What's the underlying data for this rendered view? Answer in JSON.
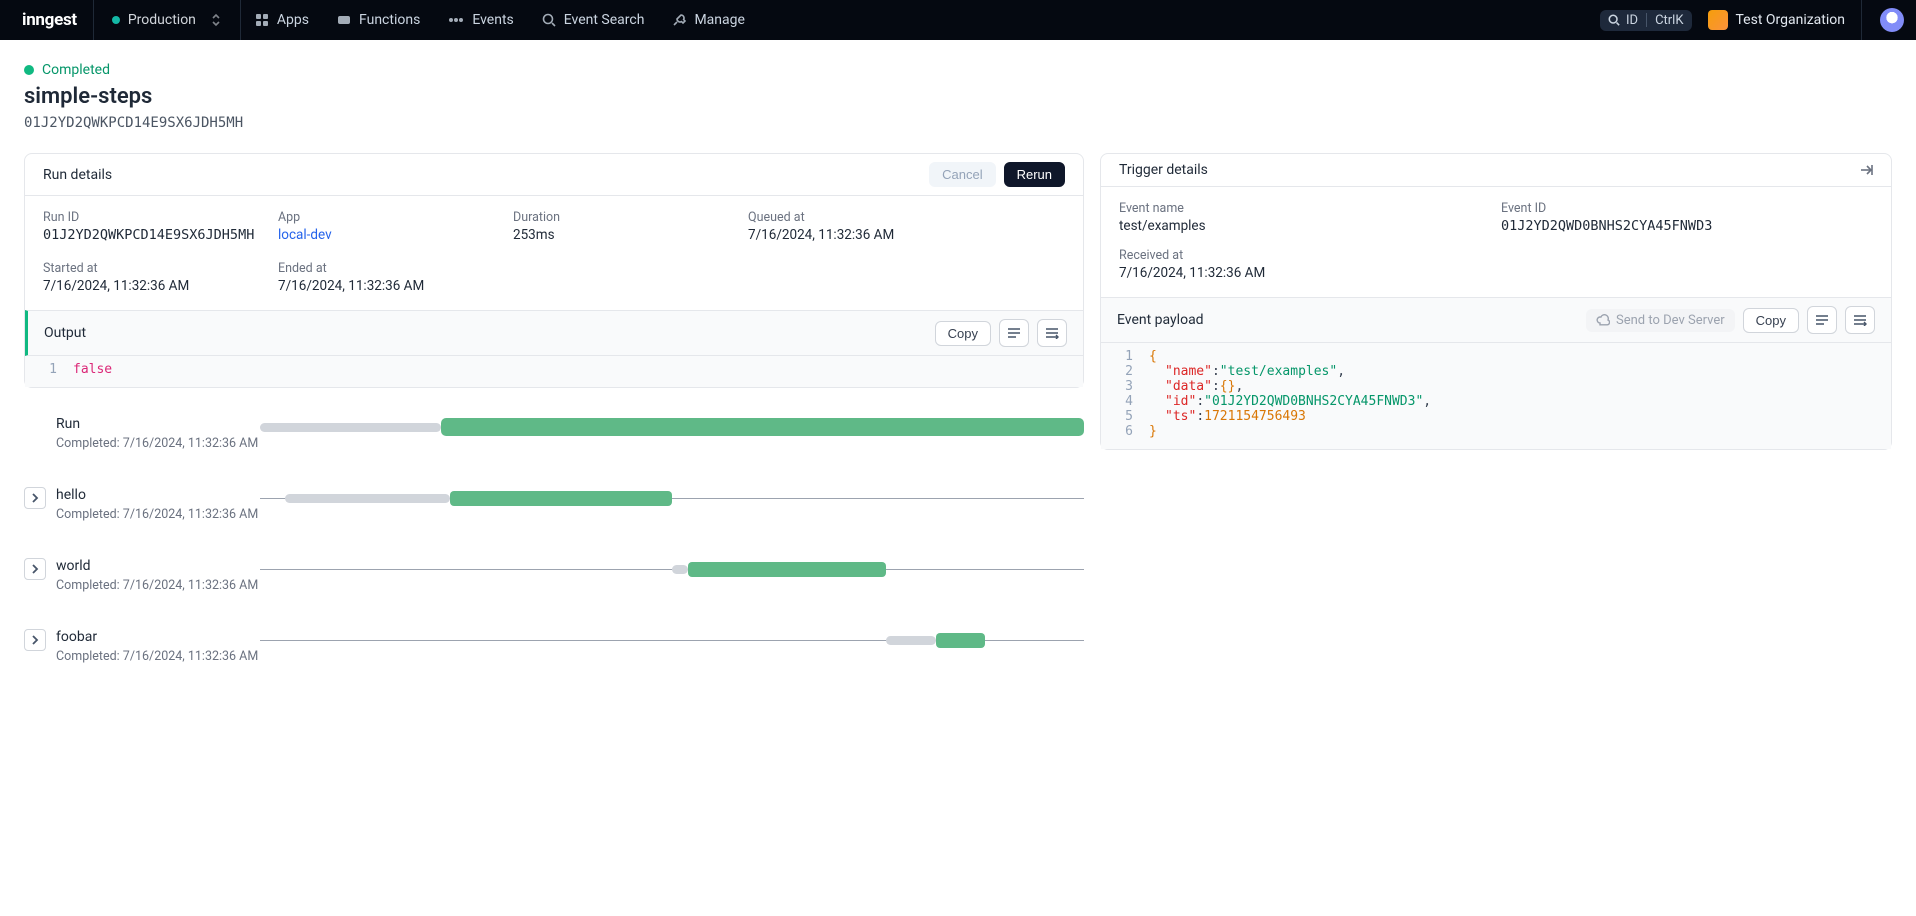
{
  "nav": {
    "brand": "inngest",
    "environment": "Production",
    "items": {
      "apps": "Apps",
      "functions": "Functions",
      "events": "Events",
      "event_search": "Event Search",
      "manage": "Manage"
    },
    "search_label": "ID",
    "search_kbd": "CtrlK",
    "org": "Test Organization"
  },
  "header": {
    "status": "Completed",
    "title": "simple-steps",
    "run_id": "01J2YD2QWKPCD14E9SX6JDH5MH"
  },
  "run_details": {
    "panel_title": "Run details",
    "cancel_label": "Cancel",
    "rerun_label": "Rerun",
    "fields": {
      "run_id": {
        "label": "Run ID",
        "value": "01J2YD2QWKPCD14E9SX6JDH5MH"
      },
      "app": {
        "label": "App",
        "value": "local-dev"
      },
      "duration": {
        "label": "Duration",
        "value": "253ms"
      },
      "queued": {
        "label": "Queued at",
        "value": "7/16/2024, 11:32:36 AM"
      },
      "started": {
        "label": "Started at",
        "value": "7/16/2024, 11:32:36 AM"
      },
      "ended": {
        "label": "Ended at",
        "value": "7/16/2024, 11:32:36 AM"
      }
    },
    "output_title": "Output",
    "copy_label": "Copy",
    "output_lines": [
      {
        "n": "1",
        "false": "false"
      }
    ]
  },
  "timeline": {
    "run_row": {
      "title": "Run",
      "sub": "Completed: 7/16/2024, 11:32:36 AM"
    },
    "steps": [
      {
        "name": "hello",
        "sub": "Completed: 7/16/2024, 11:32:36 AM"
      },
      {
        "name": "world",
        "sub": "Completed: 7/16/2024, 11:32:36 AM"
      },
      {
        "name": "foobar",
        "sub": "Completed: 7/16/2024, 11:32:36 AM"
      }
    ]
  },
  "trigger": {
    "panel_title": "Trigger details",
    "event_name": {
      "label": "Event name",
      "value": "test/examples"
    },
    "event_id": {
      "label": "Event ID",
      "value": "01J2YD2QWD0BNHS2CYA45FNWD3"
    },
    "received": {
      "label": "Received at",
      "value": "7/16/2024, 11:32:36 AM"
    },
    "payload_title": "Event payload",
    "send_dev_label": "Send to Dev Server",
    "copy_label": "Copy",
    "payload": {
      "l1": "1",
      "l2": "2",
      "l3": "3",
      "l4": "4",
      "l5": "5",
      "l6": "6",
      "name_key": "\"name\"",
      "name_val": "\"test/examples\"",
      "data_key": "\"data\"",
      "id_key": "\"id\"",
      "id_val": "\"01J2YD2QWD0BNHS2CYA45FNWD3\"",
      "ts_key": "\"ts\"",
      "ts_val": "1721154756493"
    }
  }
}
